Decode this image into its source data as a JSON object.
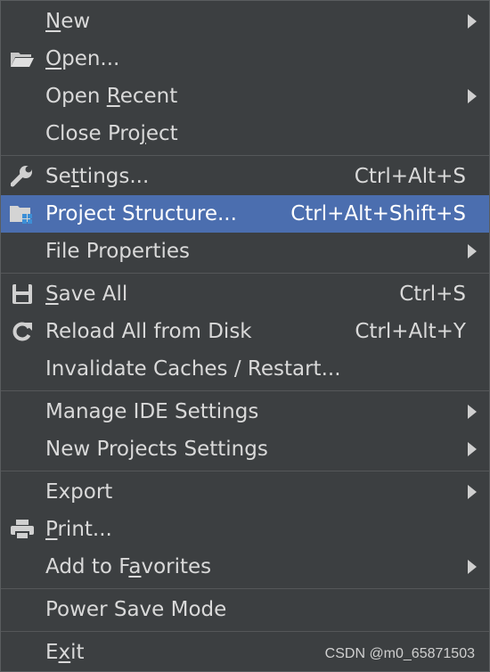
{
  "menu": {
    "new": {
      "pre": "",
      "mn": "N",
      "post": "ew"
    },
    "open": {
      "pre": "",
      "mn": "O",
      "post": "pen..."
    },
    "open_recent": {
      "pre": "Open ",
      "mn": "R",
      "post": "ecent"
    },
    "close_project": {
      "pre": "Close Pro",
      "mn": "j",
      "post": "ect"
    },
    "settings": {
      "pre": "Se",
      "mn": "t",
      "post": "tings...",
      "shortcut": "Ctrl+Alt+S"
    },
    "project_structure": {
      "pre": "Project Structure...",
      "mn": "",
      "post": "",
      "shortcut": "Ctrl+Alt+Shift+S"
    },
    "file_properties": {
      "pre": "File Properties",
      "mn": "",
      "post": ""
    },
    "save_all": {
      "pre": "",
      "mn": "S",
      "post": "ave All",
      "shortcut": "Ctrl+S"
    },
    "reload_all": {
      "pre": "Reload All from Disk",
      "mn": "",
      "post": "",
      "shortcut": "Ctrl+Alt+Y"
    },
    "invalidate_caches": {
      "pre": "Invalidate Caches / Restart...",
      "mn": "",
      "post": ""
    },
    "manage_ide_settings": {
      "pre": "Manage IDE Settings",
      "mn": "",
      "post": ""
    },
    "new_projects_settings": {
      "pre": "New Projects Settings",
      "mn": "",
      "post": ""
    },
    "export": {
      "pre": "Export",
      "mn": "",
      "post": ""
    },
    "print": {
      "pre": "",
      "mn": "P",
      "post": "rint..."
    },
    "add_to_favorites": {
      "pre": "Add to F",
      "mn": "a",
      "post": "vorites"
    },
    "power_save_mode": {
      "pre": "Power Save Mode",
      "mn": "",
      "post": ""
    },
    "exit": {
      "pre": "E",
      "mn": "x",
      "post": "it"
    }
  },
  "watermark": "CSDN @m0_65871503",
  "colors": {
    "background": "#3c3f41",
    "highlight": "#4b6eaf",
    "text": "#d9d9d9"
  },
  "icons": {
    "open": "folder-open-icon",
    "settings": "wrench-icon",
    "project_structure": "project-structure-icon",
    "save_all": "save-icon",
    "reload_all": "reload-icon",
    "print": "printer-icon"
  }
}
